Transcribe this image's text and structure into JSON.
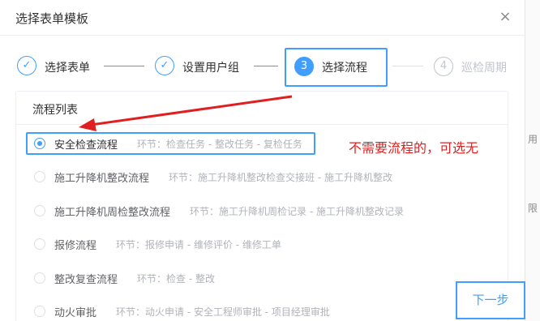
{
  "dialog": {
    "title": "选择表单模板",
    "close_glyph": "×"
  },
  "steps": [
    {
      "index": "✓",
      "label": "选择表单",
      "status": "done"
    },
    {
      "index": "✓",
      "label": "设置用户组",
      "status": "done"
    },
    {
      "index": "3",
      "label": "选择流程",
      "status": "active"
    },
    {
      "index": "4",
      "label": "巡检周期",
      "status": "wait"
    }
  ],
  "panel": {
    "title": "流程列表"
  },
  "flows": [
    {
      "name": "安全检查流程",
      "nodes": "环节：检查任务 - 整改任务 - 复检任务",
      "selected": true
    },
    {
      "name": "施工升降机整改流程",
      "nodes": "环节：施工升降机整改检查交接班 - 施工升降机整改",
      "selected": false
    },
    {
      "name": "施工升降机周检整改流程",
      "nodes": "环节：施工升降机周检记录 - 施工升降机整改记录",
      "selected": false
    },
    {
      "name": "报修流程",
      "nodes": "环节：报修申请 - 维修评价 - 维修工单",
      "selected": false
    },
    {
      "name": "整改复查流程",
      "nodes": "环节：检查 - 整改",
      "selected": false
    },
    {
      "name": "动火审批",
      "nodes": "环节：动火申请 - 安全工程师审批 - 项目经理审批",
      "selected": false
    }
  ],
  "annotation": "不需要流程的，可选无",
  "next_button": "下一步",
  "background_fragments": [
    "用",
    "限"
  ],
  "colors": {
    "primary": "#409eff",
    "annotation_red": "#e02020"
  },
  "icons": {
    "close": "close-icon",
    "check": "check-icon",
    "arrow": "red-arrow"
  }
}
